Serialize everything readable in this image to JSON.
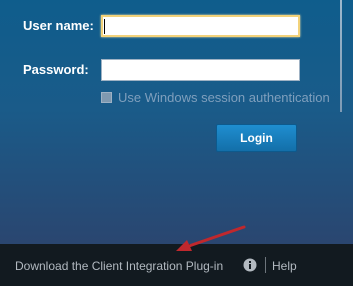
{
  "form": {
    "username_label": "User name:",
    "username_value": "",
    "password_label": "Password:",
    "password_value": "",
    "windows_auth_label": "Use Windows session authentication",
    "windows_auth_checked": false,
    "login_label": "Login"
  },
  "footer": {
    "download_label": "Download the Client Integration Plug-in",
    "info_icon": "info-icon",
    "help_label": "Help"
  },
  "annotation": {
    "icon": "red-arrow",
    "color": "#c0282d"
  },
  "colors": {
    "panel_accent": "#1a5b89",
    "button_accent": "#1a82c2",
    "footer_bg": "#121a20",
    "focus_ring": "#f2d27a"
  }
}
